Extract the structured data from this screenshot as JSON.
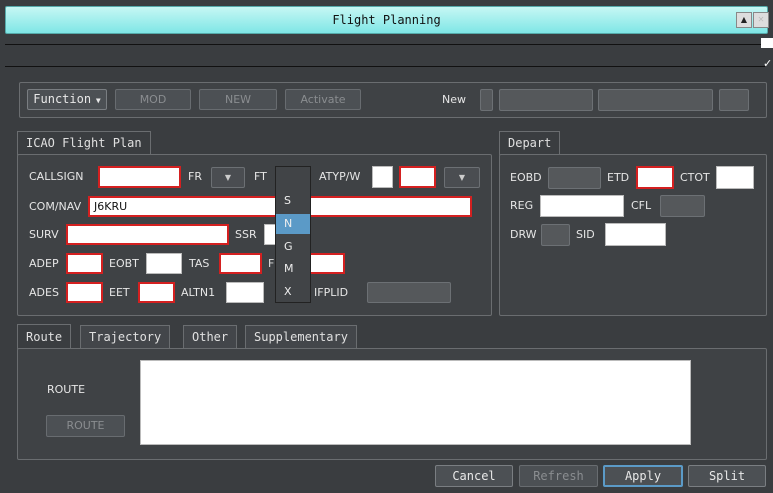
{
  "window": {
    "title": "Flight Planning"
  },
  "toolbar": {
    "function_label": "Function",
    "mod_label": "MOD",
    "new_button_label": "NEW",
    "activate_label": "Activate",
    "new_label": "New"
  },
  "icao": {
    "group_title": "ICAO Flight Plan",
    "callsign_label": "CALLSIGN",
    "fr_label": "FR",
    "ft_label": "FT",
    "atyp_label": "ATYP/W",
    "comnav_label": "COM/NAV",
    "comnav_value": "J6KRU",
    "surv_label": "SURV",
    "ssr_label": "SSR",
    "adep_label": "ADEP",
    "eobt_label": "EOBT",
    "tas_label": "TAS",
    "fl_label": "F",
    "ades_label": "ADES",
    "eet_label": "EET",
    "altn1_label": "ALTN1",
    "ifplid_label": "IFPLID"
  },
  "ft_popup": {
    "options": [
      "S",
      "N",
      "G",
      "M",
      "X"
    ],
    "selected": "N"
  },
  "depart": {
    "group_title": "Depart",
    "eobd_label": "EOBD",
    "etd_label": "ETD",
    "ctot_label": "CTOT",
    "reg_label": "REG",
    "cfl_label": "CFL",
    "drw_label": "DRW",
    "sid_label": "SID"
  },
  "tabs": {
    "route": "Route",
    "trajectory": "Trajectory",
    "other": "Other",
    "supplementary": "Supplementary"
  },
  "route": {
    "label": "ROUTE",
    "button_label": "ROUTE"
  },
  "footer": {
    "cancel": "Cancel",
    "refresh": "Refresh",
    "apply": "Apply",
    "split": "Split"
  },
  "colors": {
    "title_bar": "#7fe6e6",
    "required_border": "#d42020",
    "selection": "#5b9ac7"
  }
}
